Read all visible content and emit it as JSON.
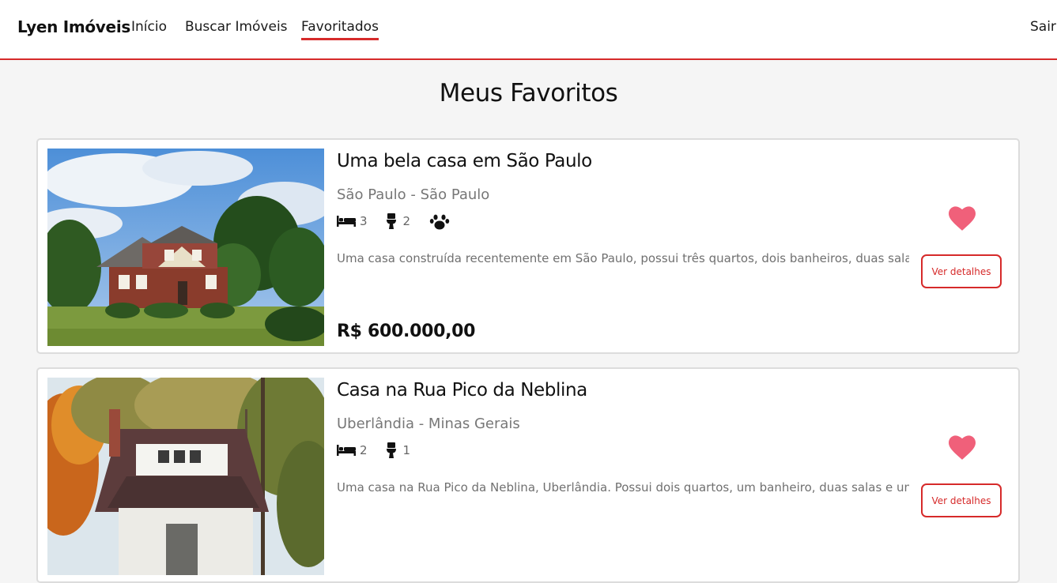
{
  "navbar": {
    "brand": "Lyen Imóveis",
    "links": [
      "Início",
      "Buscar Imóveis",
      "Favoritados"
    ],
    "active": "Favoritados",
    "logout": "Sair"
  },
  "page": {
    "title": "Meus Favoritos"
  },
  "colors": {
    "accent": "#d62a2a",
    "heart": "#f0607a"
  },
  "favorites": [
    {
      "title": "Uma bela casa em São Paulo",
      "location": "São Paulo - São Paulo",
      "bedrooms": "3",
      "bathrooms": "2",
      "pets": true,
      "icons": [
        "bed-icon",
        "toilet-icon",
        "paw-icon"
      ],
      "description": "Uma casa construída recentemente em São Paulo, possui três quartos, dois banheiros, duas salas",
      "price": "R$ 600.000,00",
      "favorited": true,
      "details_label": "Ver detalhes"
    },
    {
      "title": "Casa na Rua Pico da Neblina",
      "location": "Uberlândia - Minas Gerais",
      "bedrooms": "2",
      "bathrooms": "1",
      "pets": false,
      "icons": [
        "bed-icon",
        "toilet-icon"
      ],
      "description": "Uma casa na Rua Pico da Neblina, Uberlândia. Possui dois quartos, um banheiro, duas salas e um",
      "favorited": true,
      "details_label": "Ver detalhes"
    }
  ]
}
